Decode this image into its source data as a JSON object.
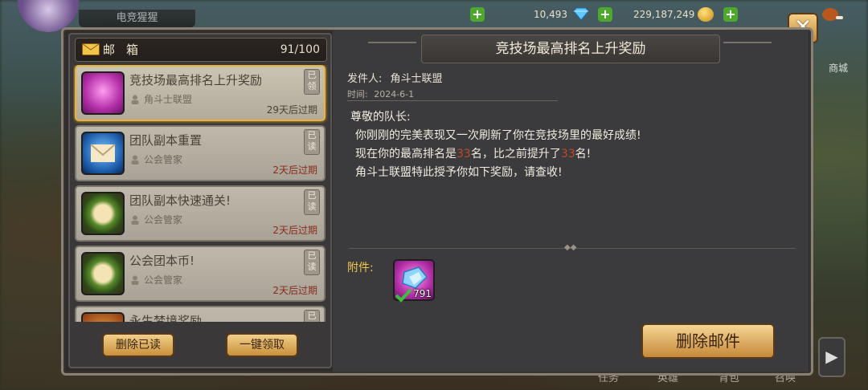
{
  "top": {
    "name_plate": "电竞猩猩",
    "gems": "10,493",
    "gold": "229,187,249"
  },
  "mailbox": {
    "title": "邮箱",
    "count": "91/100",
    "items": [
      {
        "subject": "竞技场最高排名上升奖励",
        "sender": "角斗士联盟",
        "expire": "29天后过期",
        "tag": "已领",
        "icon": "gem-crystal-icon"
      },
      {
        "subject": "团队副本重置",
        "sender": "公会管家",
        "expire": "2天后过期",
        "tag": "已读",
        "icon": "envelope-icon"
      },
      {
        "subject": "团队副本快速通关!",
        "sender": "公会管家",
        "expire": "2天后过期",
        "tag": "已读",
        "icon": "wreath-envelope-icon"
      },
      {
        "subject": "公会团本币!",
        "sender": "公会管家",
        "expire": "2天后过期",
        "tag": "已读",
        "icon": "wreath-envelope-icon"
      },
      {
        "subject": "永生梦境奖励",
        "sender": "",
        "expire": "",
        "tag": "已读",
        "icon": "orange-icon"
      }
    ],
    "delete_read": "删除已读",
    "claim_all": "一键领取"
  },
  "detail": {
    "title": "竞技场最高排名上升奖励",
    "sender_label": "发件人:",
    "sender": "角斗士联盟",
    "date_label": "时间:",
    "date": "2024-6-1",
    "greeting": "尊敬的队长:",
    "line1": "你刚刚的完美表现又一次刷新了你在竞技场里的最好成绩!",
    "line2_a": "现在你的最高排名是",
    "rank": "33",
    "line2_b": "名，比之前提升了",
    "improve": "33",
    "line2_c": "名!",
    "line3": "角斗士联盟特此授予你如下奖励，请查收!",
    "attach_label": "附件:",
    "attach_qty": "791",
    "delete_mail": "删除邮件"
  },
  "side": {
    "shop": "商城"
  },
  "bottom_tabs": [
    "任务",
    "英雄",
    "背包",
    "召唤"
  ],
  "colors": {
    "accent_gold": "#e8b43a",
    "expire_red": "#8a2a1a",
    "highlight_red": "#c0482a",
    "attach_label": "#f0c84a"
  }
}
